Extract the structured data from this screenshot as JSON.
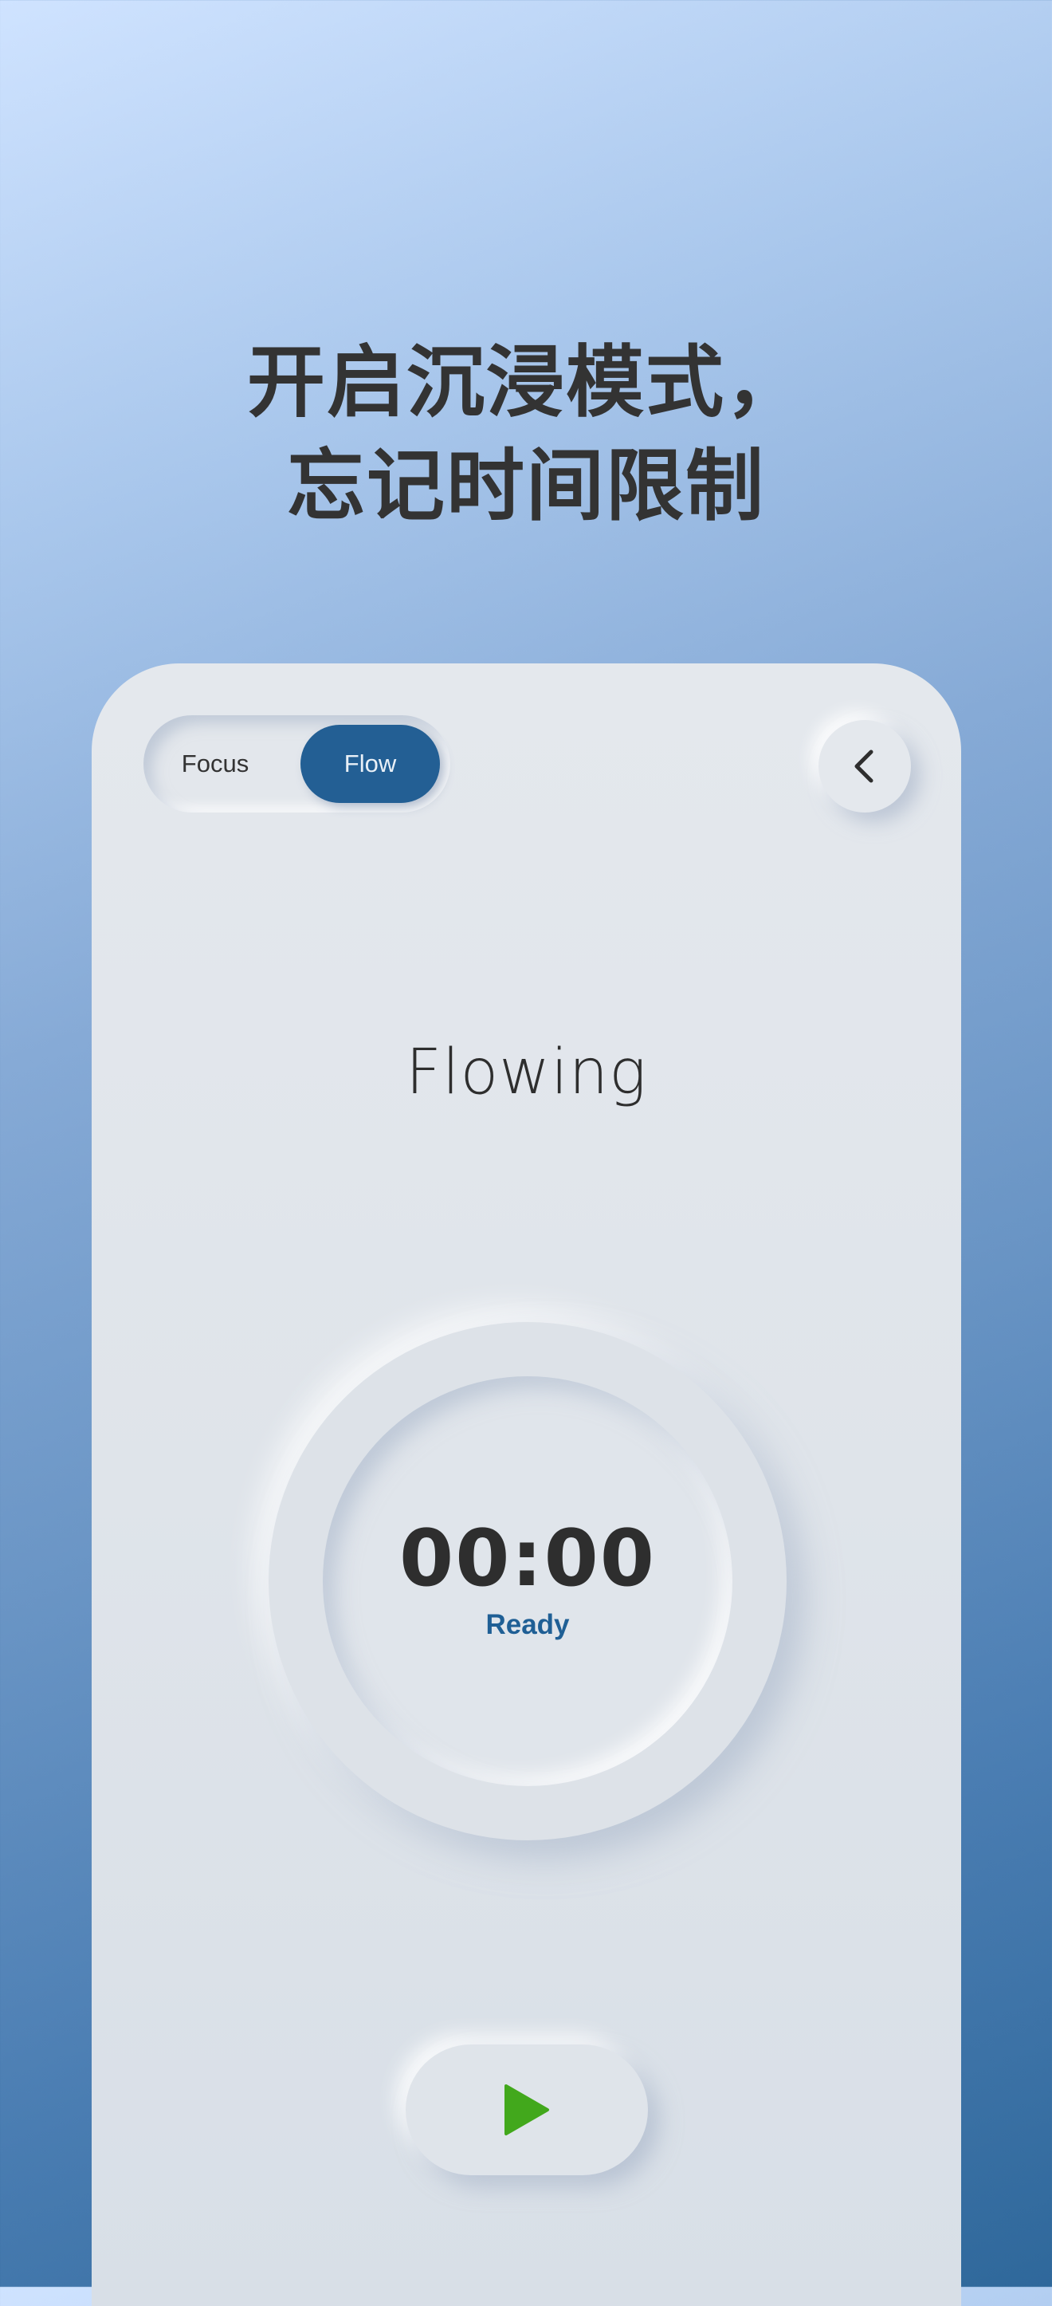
{
  "headline": {
    "line1": "开启沉浸模式，",
    "line2": "忘记时间限制"
  },
  "mode_toggle": {
    "options": [
      {
        "label": "Focus",
        "selected": false
      },
      {
        "label": "Flow",
        "selected": true
      }
    ]
  },
  "back_button": {
    "icon": "chevron-left-icon"
  },
  "mode_title": "Flowing",
  "timer": {
    "value": "00:00",
    "status": "Ready"
  },
  "play_button": {
    "icon": "play-icon"
  },
  "colors": {
    "accent": "#235f94",
    "status_text": "#1f5f95",
    "play_icon": "#42a81c",
    "text_dark": "#2e2e2e"
  }
}
